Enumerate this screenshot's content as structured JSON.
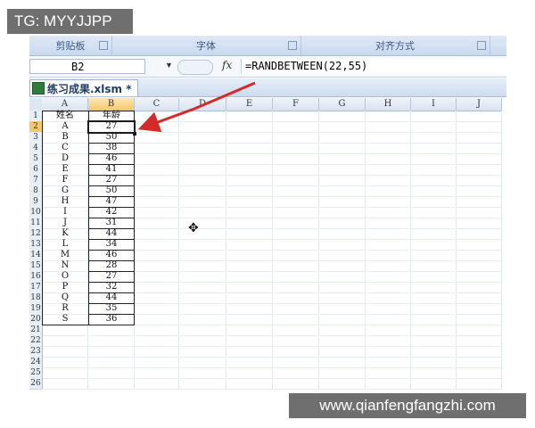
{
  "overlay": {
    "tg_label": "TG: MYYJJPP",
    "watermark": "www.qianfengfangzhi.com"
  },
  "ribbon": {
    "groups": [
      "剪贴板",
      "字体",
      "对齐方式"
    ]
  },
  "formula_bar": {
    "name_box": "B2",
    "fx_label": "fx",
    "formula": "=RANDBETWEEN(22,55)"
  },
  "workbook": {
    "tab_title": "练习成果.xlsm *"
  },
  "sheet": {
    "columns": [
      "A",
      "B",
      "C",
      "D",
      "E",
      "F",
      "G",
      "H",
      "I",
      "J"
    ],
    "rows": [
      "1",
      "2",
      "3",
      "4",
      "5",
      "6",
      "7",
      "8",
      "9",
      "10",
      "11",
      "12",
      "13",
      "14",
      "15",
      "16",
      "17",
      "18",
      "19",
      "20",
      "21",
      "22",
      "23",
      "24",
      "25",
      "26"
    ],
    "header": {
      "a": "姓名",
      "b": "年龄"
    },
    "data": [
      {
        "name": "A",
        "age": "27"
      },
      {
        "name": "B",
        "age": "50"
      },
      {
        "name": "C",
        "age": "38"
      },
      {
        "name": "D",
        "age": "46"
      },
      {
        "name": "E",
        "age": "41"
      },
      {
        "name": "F",
        "age": "27"
      },
      {
        "name": "G",
        "age": "50"
      },
      {
        "name": "H",
        "age": "47"
      },
      {
        "name": "I",
        "age": "42"
      },
      {
        "name": "J",
        "age": "31"
      },
      {
        "name": "K",
        "age": "44"
      },
      {
        "name": "L",
        "age": "34"
      },
      {
        "name": "M",
        "age": "46"
      },
      {
        "name": "N",
        "age": "28"
      },
      {
        "name": "O",
        "age": "27"
      },
      {
        "name": "P",
        "age": "32"
      },
      {
        "name": "Q",
        "age": "44"
      },
      {
        "name": "R",
        "age": "35"
      },
      {
        "name": "S",
        "age": "36"
      }
    ],
    "selected_cell": "B2"
  },
  "colors": {
    "arrow": "#d42a2a",
    "selected_header": "#f6c86a"
  }
}
